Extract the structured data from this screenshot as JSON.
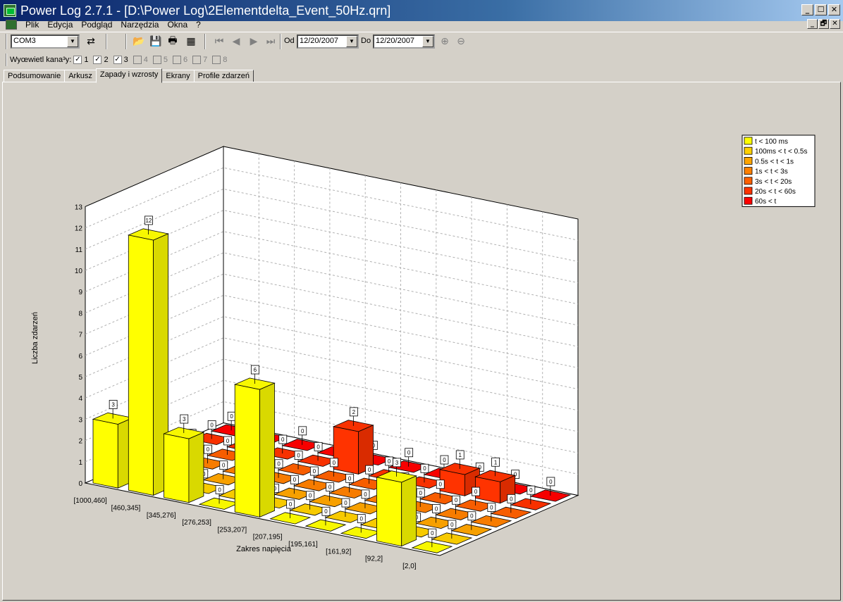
{
  "window": {
    "title": "Power Log 2.7.1 - [D:\\Power Log\\2Elementdelta_Event_50Hz.qrn]",
    "min": "_",
    "max": "☐",
    "close": "✕",
    "mdi_restore": "🗗"
  },
  "menu": {
    "items": [
      "Plik",
      "Edycja",
      "Podgląd",
      "Narzędzia",
      "Okna",
      "?"
    ]
  },
  "toolbar": {
    "port": "COM3",
    "from_label": "Od",
    "from_date": "12/20/2007",
    "to_label": "Do",
    "to_date": "12/20/2007"
  },
  "channels": {
    "label": "Wyœwietl kana³y:",
    "items": [
      {
        "num": "1",
        "checked": true,
        "enabled": true
      },
      {
        "num": "2",
        "checked": true,
        "enabled": true
      },
      {
        "num": "3",
        "checked": true,
        "enabled": true
      },
      {
        "num": "4",
        "checked": false,
        "enabled": false
      },
      {
        "num": "5",
        "checked": false,
        "enabled": false
      },
      {
        "num": "6",
        "checked": false,
        "enabled": false
      },
      {
        "num": "7",
        "checked": false,
        "enabled": false
      },
      {
        "num": "8",
        "checked": false,
        "enabled": false
      }
    ]
  },
  "tabs": [
    "Podsumowanie",
    "Arkusz",
    "Zapady i wzrosty",
    "Ekrany",
    "Profile zdarzeń"
  ],
  "active_tab": 2,
  "chart_data": {
    "type": "bar",
    "xlabel": "Zakres napięcia",
    "ylabel": "Liczba zdarzeń",
    "ylim": [
      0,
      13
    ],
    "yticks": [
      "0",
      "1",
      "2",
      "3",
      "4",
      "5",
      "6",
      "7",
      "8",
      "9",
      "10",
      "11",
      "12",
      "13"
    ],
    "categories": [
      "[1000,460]",
      "[460,345]",
      "[345,276]",
      "[276,253]",
      "[253,207]",
      "[207,195]",
      "[195,161]",
      "[161,92]",
      "[92,2]",
      "[2,0]"
    ],
    "series": [
      {
        "name": "t < 100 ms",
        "color": "#ffff00",
        "values": [
          3,
          12,
          3,
          0,
          6,
          0,
          0,
          0,
          3,
          0
        ]
      },
      {
        "name": "100ms < t < 0.5s",
        "color": "#ffd000",
        "values": [
          0,
          0,
          0,
          0,
          0,
          0,
          0,
          0,
          0,
          0
        ]
      },
      {
        "name": "0.5s < t < 1s",
        "color": "#ffa500",
        "values": [
          0,
          0,
          0,
          0,
          0,
          0,
          0,
          0,
          0,
          0
        ]
      },
      {
        "name": "1s < t < 3s",
        "color": "#ff8000",
        "values": [
          0,
          0,
          0,
          0,
          0,
          0,
          0,
          0,
          0,
          0
        ]
      },
      {
        "name": "3s < t < 20s",
        "color": "#ff6000",
        "values": [
          0,
          0,
          0,
          0,
          0,
          0,
          0,
          0,
          0,
          0
        ]
      },
      {
        "name": "20s < t < 60s",
        "color": "#ff3300",
        "values": [
          0,
          0,
          0,
          0,
          2,
          0,
          0,
          1,
          1,
          0
        ]
      },
      {
        "name": "60s < t",
        "color": "#ff0000",
        "values": [
          0,
          0,
          0,
          0,
          0,
          0,
          0,
          0,
          0,
          0
        ]
      }
    ],
    "legend_position": "top-right",
    "grid": true
  }
}
